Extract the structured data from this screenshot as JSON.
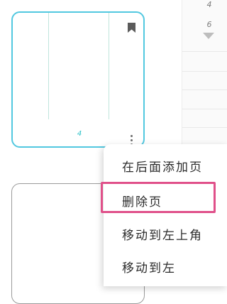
{
  "right_strip": {
    "numbers": [
      "4",
      "6"
    ]
  },
  "page_thumbnail": {
    "page_number": "4"
  },
  "menu": {
    "items": [
      "在后面添加页",
      "删除页",
      "移动到左上角",
      "移动到左"
    ],
    "highlighted_index": 1,
    "highlight_color": "#e0508a"
  },
  "colors": {
    "selected_border": "#52c8e0",
    "page_number": "#2dc2c8"
  },
  "icons": {
    "bookmark": "bookmark-icon",
    "more": "more-vertical-icon",
    "scroll_down": "triangle-down-icon"
  }
}
